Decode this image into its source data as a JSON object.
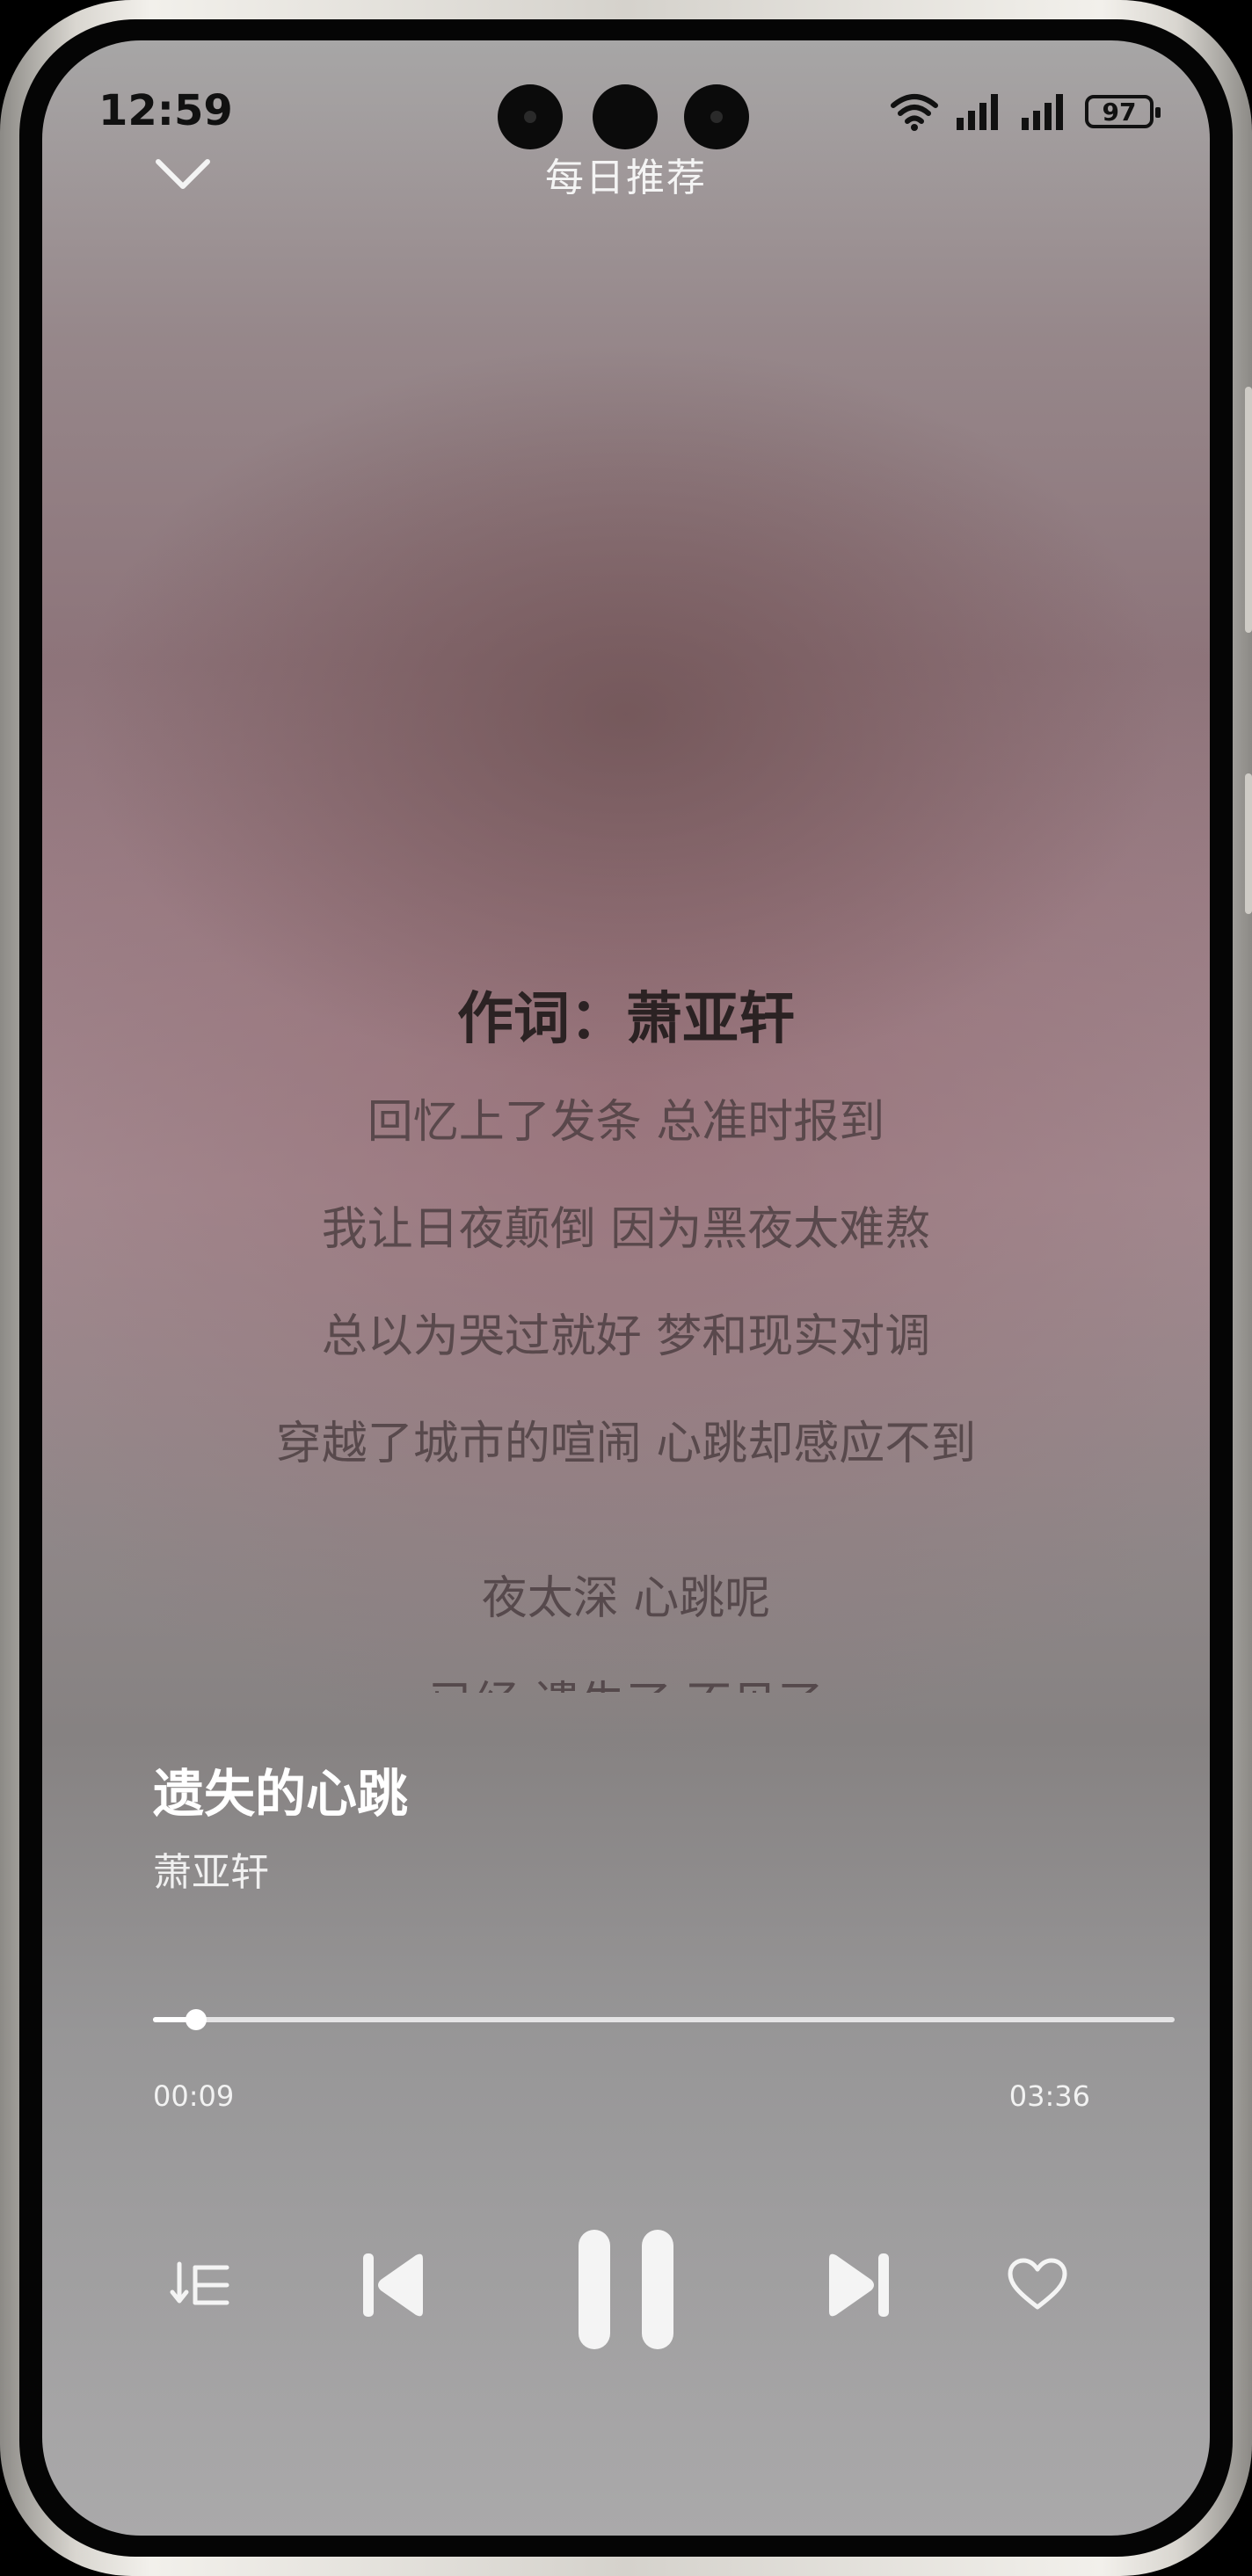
{
  "status_bar": {
    "time": "12:59",
    "battery": "97",
    "icons": [
      "wifi-icon",
      "signal-icon",
      "signal-icon",
      "battery-icon"
    ]
  },
  "header": {
    "title": "每日推荐",
    "collapse_icon": "chevron-down-icon"
  },
  "lyrics": {
    "lines": [
      "作词：萧亚轩",
      "回忆上了发条 总准时报到",
      "我让日夜颠倒 因为黑夜太难熬",
      "总以为哭过就好 梦和现实对调",
      "穿越了城市的喧闹 心跳却感应不到",
      "夜太深 心跳呢",
      "已经 遗失了 不见了"
    ],
    "current_index": 0
  },
  "song": {
    "title": "遗失的心跳",
    "artist": "萧亚轩"
  },
  "progress": {
    "current_time": "00:09",
    "total_time": "03:36",
    "fraction": 0.042
  },
  "controls": {
    "playlist_icon": "playlist-order-icon",
    "previous_icon": "previous-track-icon",
    "pause_icon": "pause-icon",
    "next_icon": "next-track-icon",
    "like_icon": "heart-icon"
  },
  "colors": {
    "text_primary": "#ffffff",
    "lyric_active": "#2b2223",
    "lyric_inactive": "#463a3c"
  }
}
